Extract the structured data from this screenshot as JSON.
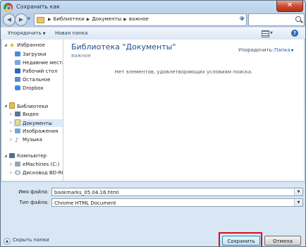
{
  "window": {
    "title": "Сохранить как"
  },
  "navigation": {
    "breadcrumbs": [
      "Библиотеки",
      "Документы",
      "важное"
    ],
    "search_placeholder": ""
  },
  "toolbar": {
    "organize": "Упорядочить",
    "new_folder": "Новая папка"
  },
  "sidebar": {
    "items": [
      {
        "label": "Избранное",
        "icon": "star-icon",
        "group": true
      },
      {
        "label": "Загрузки",
        "icon": "downloads-folder-icon"
      },
      {
        "label": "Недавние места",
        "icon": "recent-places-icon"
      },
      {
        "label": "Рабочий стол",
        "icon": "desktop-icon"
      },
      {
        "label": "Остальное",
        "icon": "folder-icon"
      },
      {
        "label": "Dropbox",
        "icon": "dropbox-icon"
      },
      {
        "label": "Библиотеки",
        "icon": "libraries-icon",
        "group": true
      },
      {
        "label": "Видео",
        "icon": "video-library-icon"
      },
      {
        "label": "Документы",
        "icon": "documents-library-icon",
        "selected": true
      },
      {
        "label": "Изображения",
        "icon": "pictures-library-icon"
      },
      {
        "label": "Музыка",
        "icon": "music-library-icon"
      },
      {
        "label": "Компьютер",
        "icon": "computer-icon",
        "group": true
      },
      {
        "label": "eMachines (C:)",
        "icon": "hard-drive-icon"
      },
      {
        "label": "Дисковод BD-RO",
        "icon": "bd-drive-icon"
      }
    ]
  },
  "content": {
    "library_title": "Библиотека \"Документы\"",
    "library_subtitle": "важное",
    "arrange_label": "Упорядочить:",
    "arrange_value": "Папка",
    "empty_message": "Нет элементов, удовлетворяющих условиям поиска."
  },
  "form": {
    "filename_label": "Имя файла:",
    "filename_value": "bookmarks_05.04.16.html",
    "filetype_label": "Тип файла:",
    "filetype_value": "Chrome HTML Document"
  },
  "footer": {
    "hide_folders": "Скрыть папки",
    "save_label": "Сохранить",
    "cancel_label": "Отмена"
  },
  "colors": {
    "highlight": "#d0121a",
    "accent": "#1e64b8"
  }
}
